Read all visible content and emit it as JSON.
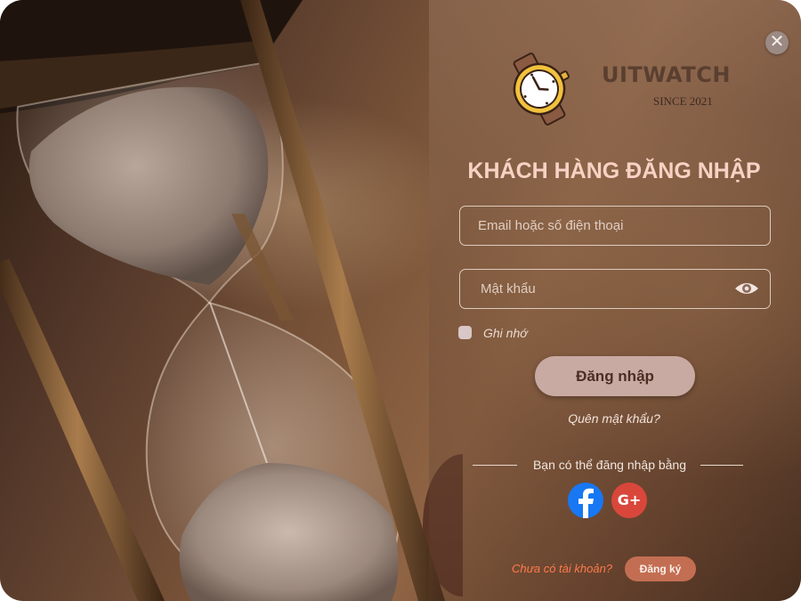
{
  "brand": {
    "name": "UITWATCH",
    "since": "SINCE 2021",
    "logo_icon": "wristwatch-icon"
  },
  "close_button": {
    "icon": "close-icon",
    "glyph": "✕"
  },
  "form": {
    "title": "KHÁCH HÀNG ĐĂNG NHẬP",
    "email_placeholder": "Email hoặc số điện thoại",
    "email_value": "",
    "password_placeholder": "Mật khẩu",
    "password_value": "",
    "password_toggle_icon": "eye-icon",
    "remember_label": "Ghi nhớ",
    "remember_checked": false,
    "login_label": "Đăng nhập",
    "forgot_label": "Quên mật khẩu?"
  },
  "social": {
    "divider_text": "Bạn có thể đăng nhập bằng",
    "facebook_icon": "facebook-icon",
    "google_icon": "google-plus-icon",
    "google_glyph": "G+"
  },
  "signup": {
    "prompt": "Chưa có tài khoản?",
    "button_label": "Đăng ký"
  },
  "colors": {
    "title": "#f7d2c4",
    "login_button": "#c8aaa2",
    "register_button": "#c36e52",
    "signup_prompt": "#ff7a4d",
    "facebook": "#1877f2",
    "google": "#d9473b"
  }
}
